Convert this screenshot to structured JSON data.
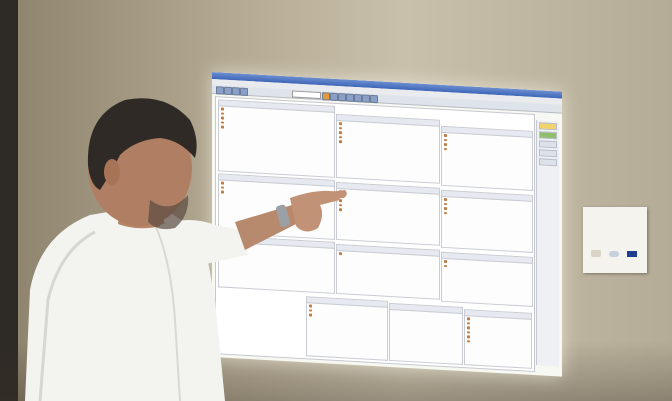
{
  "scene": {
    "description": "",
    "wall_color": "#c0b7a2"
  },
  "projection": {
    "window_title": "",
    "menu_items": [],
    "search_placeholder": ""
  },
  "notice": {
    "text": ""
  },
  "colors": {
    "titlebar": "#3e66b8",
    "shirt": "#f4f4f2",
    "hair": "#2f2a26",
    "skin": "#b88a6d"
  }
}
